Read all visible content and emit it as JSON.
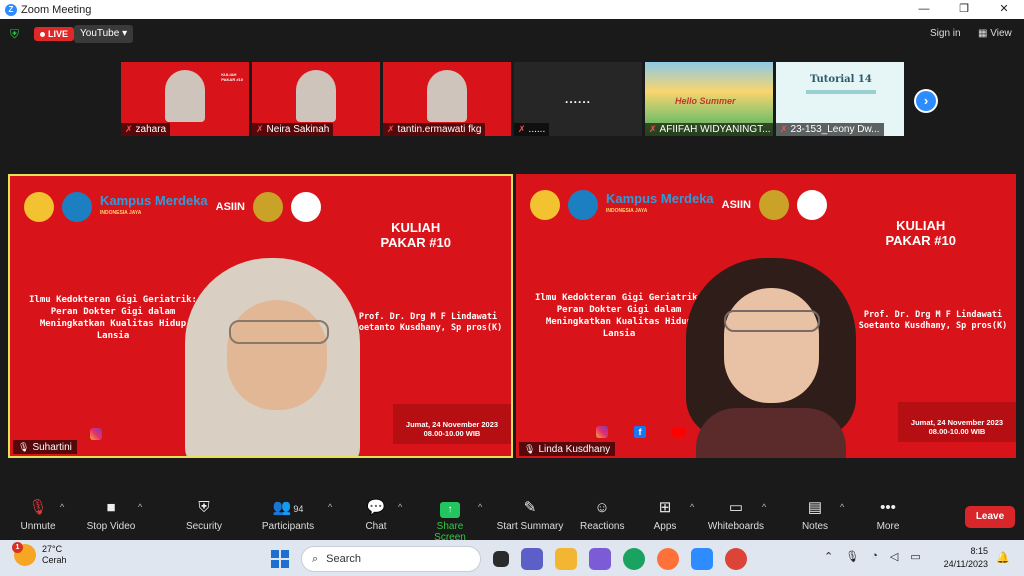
{
  "window": {
    "title": "Zoom Meeting"
  },
  "topbar": {
    "live": "LIVE",
    "stream_target": "YouTube",
    "sign_in": "Sign in",
    "view": "View"
  },
  "thumbnails": [
    {
      "name": "zahara",
      "type": "video"
    },
    {
      "name": "Neira Sakinah",
      "type": "video"
    },
    {
      "name": "tantin.ermawati fkg",
      "type": "video"
    },
    {
      "name": "......",
      "type": "dark",
      "center": "......"
    },
    {
      "name": "AFIIFAH WIDYANINGT...",
      "type": "image",
      "overlay": "Hello Summer"
    },
    {
      "name": "23-153_Leony Dw...",
      "type": "image",
      "overlay": "Tutorial 14"
    }
  ],
  "banner": {
    "kampus": "Kampus Merdeka",
    "kampus_sub": "INDONESIA JAYA",
    "asiin": "ASIIN",
    "kuliah": "KULIAH",
    "pakar": "PAKAR #10",
    "topic": "Ilmu Kedokteran Gigi Geriatrik: Peran Dokter Gigi dalam Meningkatkan Kualitas Hidup Lansia",
    "prof_line1": "Prof. Dr. Drg M F Lindawati",
    "prof_line2": "Soetanto Kusdhany, Sp pros(K)",
    "date": "Jumat, 24 November 2023",
    "time": "08.00-10.00 WIB"
  },
  "tiles": {
    "left_name": "Suhartini",
    "right_name": "Linda Kusdhany"
  },
  "toolbar": {
    "unmute": "Unmute",
    "stop_video": "Stop Video",
    "security": "Security",
    "participants": "Participants",
    "participants_count": "94",
    "chat": "Chat",
    "share_screen": "Share Screen",
    "start_summary": "Start Summary",
    "reactions": "Reactions",
    "apps": "Apps",
    "whiteboards": "Whiteboards",
    "notes": "Notes",
    "more": "More",
    "leave": "Leave"
  },
  "taskbar": {
    "temp": "27°C",
    "weather": "Cerah",
    "weather_badge": "1",
    "search": "Search",
    "time": "8:15",
    "date": "24/11/2023"
  },
  "colors": {
    "banner_red": "#d8141a",
    "zoom_blue": "#2d8cff",
    "active_border": "#e8e05a",
    "share_green": "#23c55e",
    "leave_red": "#d9262a"
  }
}
